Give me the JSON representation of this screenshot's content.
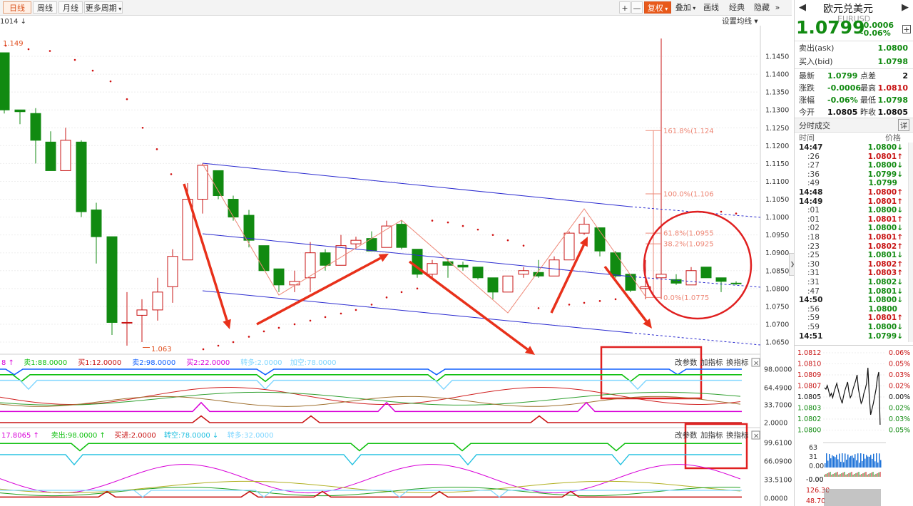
{
  "toolbar": {
    "periods": [
      "日线",
      "周线",
      "月线"
    ],
    "more_period": "更多周期",
    "zoom_in": "+",
    "zoom_out": "—",
    "fuquan": "复权",
    "overlay": "叠加",
    "draw": "画线",
    "classic": "经典",
    "hide": "隐藏",
    "more": "»"
  },
  "chart": {
    "id_label": "1014",
    "settings": "设置均线",
    "price_ticks": [
      "1.1450",
      "1.1400",
      "1.1350",
      "1.1300",
      "1.1250",
      "1.1200",
      "1.1150",
      "1.1100",
      "1.1050",
      "1.1000",
      "1.0950",
      "1.0900",
      "1.0850",
      "1.0800",
      "1.0750",
      "1.0700",
      "1.0650"
    ],
    "fib_labels": [
      "161.8%(1.124",
      "100.0%(1.106",
      "61.8%(1.0955",
      "38.2%(1.0925",
      "0.0%(1.0775"
    ],
    "high_label": "1.149",
    "low_label": "1.063"
  },
  "indicator1": {
    "legend": [
      {
        "text": "8 ↑",
        "color": "#d800d8"
      },
      {
        "text": "卖1:88.0000",
        "color": "#10c010"
      },
      {
        "text": "买1:12.0000",
        "color": "#c81414"
      },
      {
        "text": "卖2:98.0000",
        "color": "#1060ff"
      },
      {
        "text": "买2:22.0000",
        "color": "#d800d8"
      },
      {
        "text": "转多:2.0000",
        "color": "#7fd6ff"
      },
      {
        "text": "加空:78.0000",
        "color": "#7fd6ff"
      }
    ],
    "buttons": [
      "改参数",
      "加指标",
      "换指标"
    ],
    "close": "×",
    "ticks": [
      "98.0000",
      "64.4900",
      "33.7000",
      "2.0000"
    ]
  },
  "indicator2": {
    "legend": [
      {
        "text": "17.8065 ↑",
        "color": "#d800d8"
      },
      {
        "text": "卖出:98.0000 ↑",
        "color": "#10c010"
      },
      {
        "text": "买进:2.0000",
        "color": "#c81414"
      },
      {
        "text": "转空:78.0000 ↓",
        "color": "#22c0e0"
      },
      {
        "text": "转多:32.0000",
        "color": "#7fd6ff"
      }
    ],
    "buttons": [
      "改参数",
      "加指标",
      "换指标"
    ],
    "close": "×",
    "ticks": [
      "99.6100",
      "66.0900",
      "33.5100",
      "0.0000"
    ]
  },
  "panel": {
    "name": "欧元兑美元",
    "code": "EURUSD",
    "price": "1.0799",
    "change": "-0.0006",
    "change_pct": "-0.06%",
    "add": "+",
    "ask_label": "卖出(ask)",
    "ask": "1.0800",
    "bid_label": "买入(bid)",
    "bid": "1.0798",
    "stats": [
      {
        "l1": "最新",
        "v1": "1.0799",
        "c1": "green",
        "l2": "点差",
        "v2": "2",
        "c2": "dark"
      },
      {
        "l1": "涨跌",
        "v1": "-0.0006",
        "c1": "green",
        "l2": "最高",
        "v2": "1.0810",
        "c2": "red"
      },
      {
        "l1": "涨幅",
        "v1": "-0.06%",
        "c1": "green",
        "l2": "最低",
        "v2": "1.0798",
        "c2": "green"
      },
      {
        "l1": "今开",
        "v1": "1.0805",
        "c1": "dark",
        "l2": "昨收",
        "v2": "1.0805",
        "c2": "dark"
      }
    ],
    "ticks_title": "分时成交",
    "ticks_detail": "详",
    "col_time": "时间",
    "col_price": "价格",
    "ticks": [
      {
        "t": "14:47",
        "p": "1.0800",
        "d": "down"
      },
      {
        "t": ":26",
        "p": "1.0801",
        "d": "up"
      },
      {
        "t": ":27",
        "p": "1.0800",
        "d": "down"
      },
      {
        "t": ":36",
        "p": "1.0799",
        "d": "down"
      },
      {
        "t": ":49",
        "p": "1.0799",
        "d": ""
      },
      {
        "t": "14:48",
        "p": "1.0800",
        "d": "up"
      },
      {
        "t": "14:49",
        "p": "1.0801",
        "d": "up"
      },
      {
        "t": ":01",
        "p": "1.0800",
        "d": "down"
      },
      {
        "t": ":01",
        "p": "1.0801",
        "d": "up"
      },
      {
        "t": ":02",
        "p": "1.0800",
        "d": "down"
      },
      {
        "t": ":18",
        "p": "1.0801",
        "d": "up"
      },
      {
        "t": ":23",
        "p": "1.0802",
        "d": "up"
      },
      {
        "t": ":25",
        "p": "1.0801",
        "d": "down"
      },
      {
        "t": ":30",
        "p": "1.0802",
        "d": "up"
      },
      {
        "t": ":31",
        "p": "1.0803",
        "d": "up"
      },
      {
        "t": ":31",
        "p": "1.0802",
        "d": "down"
      },
      {
        "t": ":47",
        "p": "1.0801",
        "d": "down"
      },
      {
        "t": "14:50",
        "p": "1.0800",
        "d": "down"
      },
      {
        "t": ":56",
        "p": "1.0800",
        "d": ""
      },
      {
        "t": ":59",
        "p": "1.0801",
        "d": "up"
      },
      {
        "t": ":59",
        "p": "1.0800",
        "d": "down"
      },
      {
        "t": "14:51",
        "p": "1.0799",
        "d": "down"
      }
    ],
    "mini_left": [
      "1.0812",
      "1.0810",
      "1.0809",
      "1.0807",
      "1.0805",
      "1.0803",
      "1.0802",
      "1.0800"
    ],
    "mini_right": [
      "0.06%",
      "0.05%",
      "0.03%",
      "0.02%",
      "0.00%",
      "0.02%",
      "0.03%",
      "0.05%"
    ],
    "vol_labels": [
      "63",
      "31",
      "0.00"
    ],
    "osc_labels": [
      "-0.00",
      "-0.00"
    ],
    "extra_labels": [
      "126.30",
      "48.70"
    ]
  },
  "colors": {
    "up": "#c81414",
    "down": "#118a11",
    "channel": "#2c2cd0",
    "annotation": "#e8301a"
  }
}
